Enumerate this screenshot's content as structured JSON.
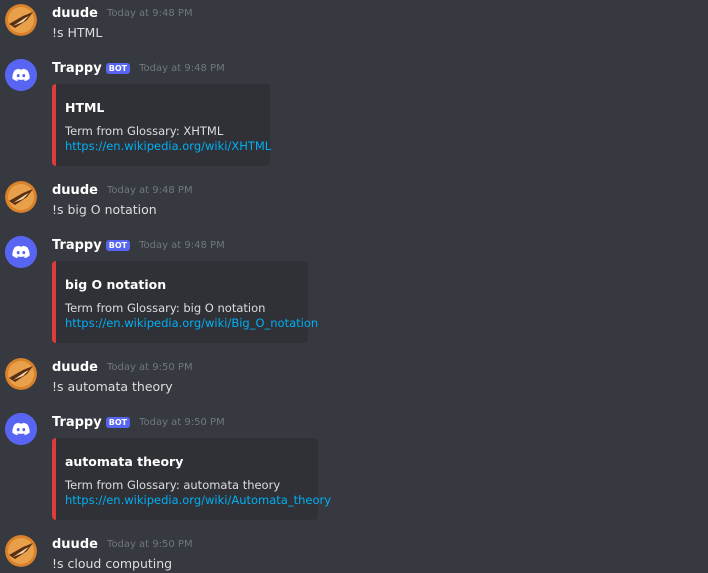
{
  "messages": [
    {
      "author": "duude",
      "timestamp": "Today at 9:48 PM",
      "content": "!s HTML"
    },
    {
      "author": "Trappy",
      "bot_tag": "BOT",
      "timestamp": "Today at 9:48 PM",
      "embed": {
        "title": "HTML",
        "description": "Term from Glossary: XHTML",
        "link": "https://en.wikipedia.org/wiki/XHTML",
        "accent_color": "#e03b3b"
      }
    },
    {
      "author": "duude",
      "timestamp": "Today at 9:48 PM",
      "content": "!s big O notation"
    },
    {
      "author": "Trappy",
      "bot_tag": "BOT",
      "timestamp": "Today at 9:48 PM",
      "embed": {
        "title": "big O notation",
        "description": "Term from Glossary: big O notation",
        "link": "https://en.wikipedia.org/wiki/Big_O_notation",
        "accent_color": "#e03b3b"
      }
    },
    {
      "author": "duude",
      "timestamp": "Today at 9:50 PM",
      "content": "!s automata theory"
    },
    {
      "author": "Trappy",
      "bot_tag": "BOT",
      "timestamp": "Today at 9:50 PM",
      "embed": {
        "title": "automata theory",
        "description": "Term from Glossary: automata theory",
        "link": "https://en.wikipedia.org/wiki/Automata_theory",
        "accent_color": "#e03b3b"
      }
    },
    {
      "author": "duude",
      "timestamp": "Today at 9:50 PM",
      "content": "!s cloud computing"
    }
  ],
  "icons": {
    "user_avatar": "user-avatar-icon",
    "bot_avatar": "discord-logo-icon"
  },
  "colors": {
    "background": "#36393f",
    "embed_background": "#2f3136",
    "embed_accent": "#e03b3b",
    "bot_tag": "#5865f2",
    "link": "#00aff4",
    "bot_avatar_bg": "#5865f2"
  }
}
